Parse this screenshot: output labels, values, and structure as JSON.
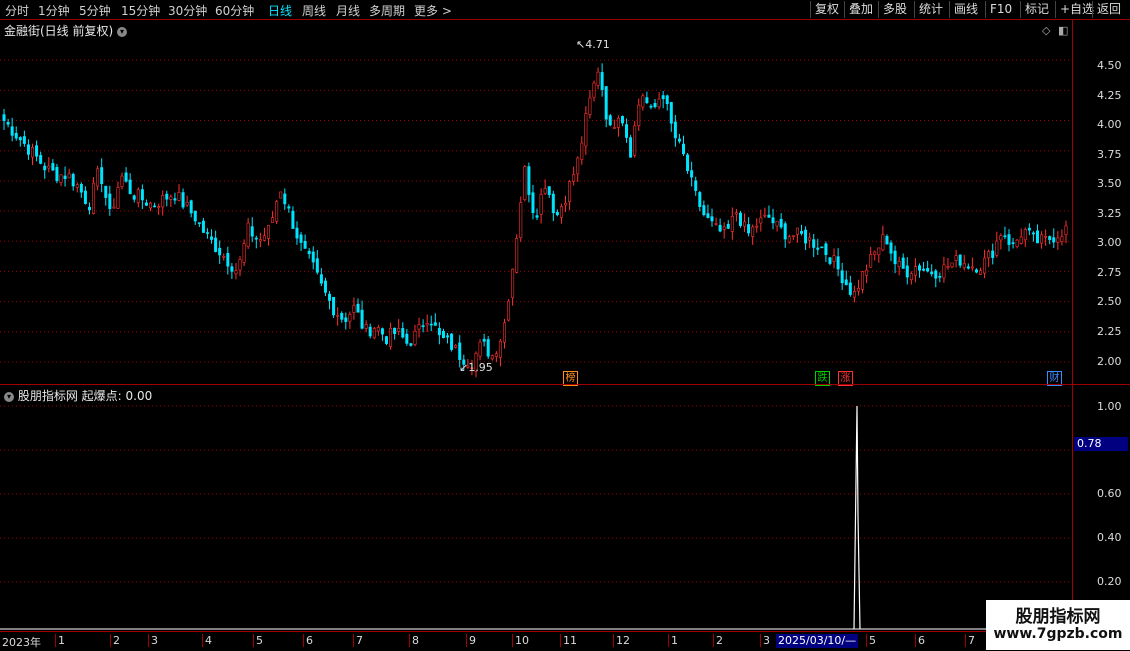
{
  "toolbar": {
    "periods": [
      "分时",
      "1分钟",
      "5分钟",
      "15分钟",
      "30分钟",
      "60分钟",
      "日线",
      "周线",
      "月线",
      "多周期",
      "更多 >"
    ],
    "active_period": "日线",
    "right_buttons": [
      "复权",
      "叠加",
      "多股",
      "统计",
      "画线",
      "F10",
      "标记",
      "+自选",
      "返回"
    ]
  },
  "main_panel": {
    "title": "金融街(日线 前复权)",
    "price_labels": [
      "4.50",
      "4.25",
      "4.00",
      "3.75",
      "3.50",
      "3.25",
      "3.00",
      "2.75",
      "2.50",
      "2.25",
      "2.00"
    ],
    "high_label": "4.71",
    "low_label": "1.95",
    "badges": [
      {
        "text": "榜",
        "color": "#ff8c1a"
      },
      {
        "text": "跌",
        "color": "#00d000"
      },
      {
        "text": "涨",
        "color": "#ff3030"
      },
      {
        "text": "财",
        "color": "#3a8cff"
      }
    ]
  },
  "indicator_panel": {
    "title": "股朋指标网 起爆点: 0.00",
    "axis_labels": [
      "1.00",
      "0.80",
      "0.60",
      "0.40",
      "0.20"
    ],
    "current_value": "0.78"
  },
  "date_axis": {
    "labels": [
      "2023年",
      "1",
      "2",
      "3",
      "4",
      "5",
      "6",
      "7",
      "8",
      "9",
      "10",
      "11",
      "12",
      "1",
      "2",
      "3"
    ],
    "selected": "2025/03/10/—",
    "labels_after": [
      "5",
      "6",
      "7"
    ]
  },
  "watermark": {
    "line1": "股朋指标网",
    "line2": "www.7gpzb.com"
  },
  "colors": {
    "up": "#ff3030",
    "down": "#00e5ff",
    "grid": "#a00000",
    "accent": "#000080"
  },
  "chart_data": {
    "type": "candlestick",
    "y_range": [
      1.9,
      4.75
    ],
    "series_close": [
      4.0,
      3.9,
      3.8,
      3.7,
      3.6,
      3.55,
      3.55,
      3.45,
      3.3,
      3.6,
      3.2,
      3.55,
      3.4,
      3.35,
      3.3,
      3.35,
      3.4,
      3.3,
      3.2,
      3.05,
      2.95,
      2.85,
      2.75,
      3.1,
      3.0,
      3.1,
      3.45,
      3.2,
      2.95,
      2.8,
      2.6,
      2.45,
      2.35,
      2.45,
      2.25,
      2.3,
      2.2,
      2.25,
      2.15,
      2.25,
      2.4,
      2.2,
      2.15,
      2.05,
      2.0,
      2.15,
      2.05,
      2.25,
      2.85,
      3.6,
      3.2,
      3.5,
      3.2,
      3.4,
      3.65,
      4.1,
      4.45,
      3.9,
      4.1,
      3.75,
      4.25,
      4.05,
      4.25,
      3.9,
      3.7,
      3.4,
      3.2,
      3.1,
      3.05,
      3.25,
      3.05,
      3.15,
      3.2,
      3.1,
      3.05,
      3.05,
      3.0,
      2.95,
      2.85,
      2.7,
      2.55,
      2.75,
      2.9,
      3.05,
      2.8,
      2.75,
      2.8,
      2.75,
      2.75,
      2.8,
      2.85,
      2.8,
      2.8,
      2.9,
      3.1,
      2.95,
      3.1,
      3.0,
      3.0,
      3.05,
      3.1
    ],
    "indicator_spike": {
      "value": 1.0,
      "position_label": "2025/03/10"
    }
  }
}
